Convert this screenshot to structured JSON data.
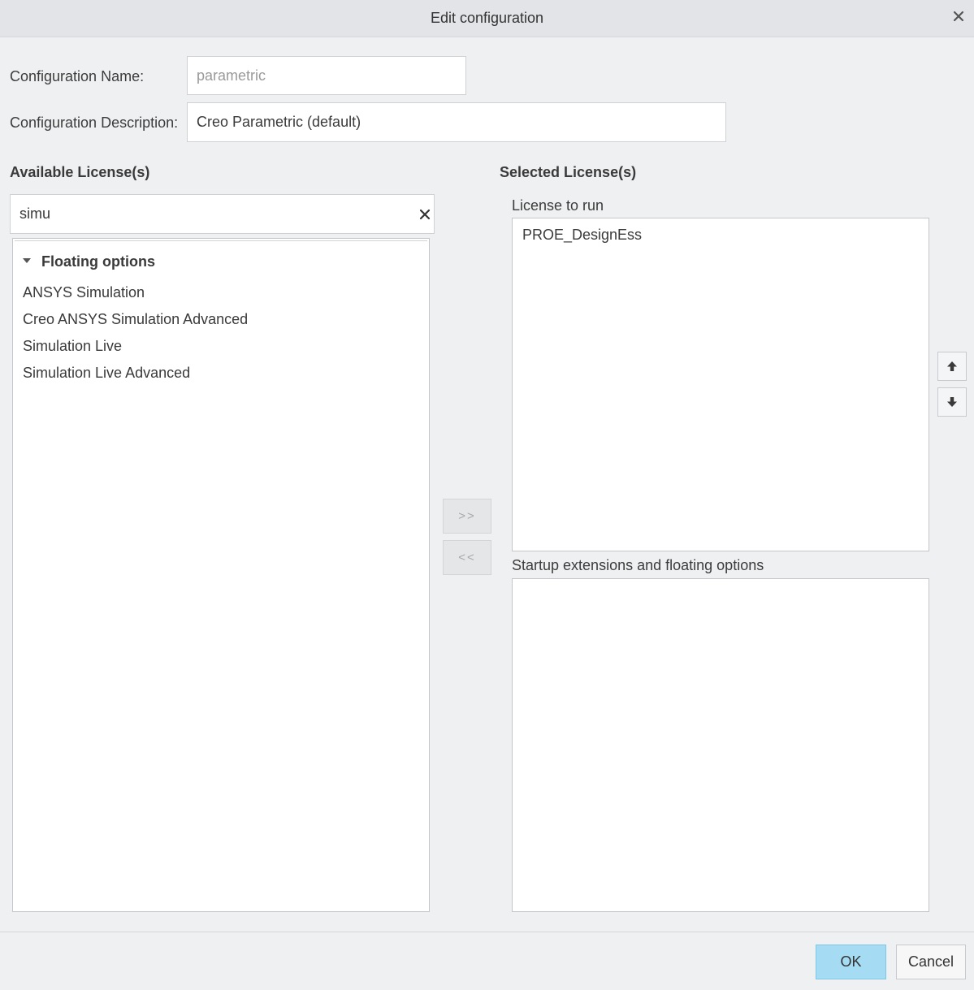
{
  "window": {
    "title": "Edit configuration"
  },
  "form": {
    "name_label": "Configuration Name:",
    "name_value": "parametric",
    "description_label": "Configuration Description:",
    "description_value": "Creo Parametric (default)"
  },
  "available": {
    "heading": "Available License(s)",
    "search_value": "simu",
    "group_label": "Floating options",
    "items": [
      "ANSYS Simulation",
      "Creo ANSYS Simulation Advanced",
      "Simulation Live",
      "Simulation Live Advanced"
    ]
  },
  "transfer": {
    "add_label": ">>",
    "remove_label": "<<"
  },
  "selected": {
    "heading": "Selected License(s)",
    "run_label": "License to run",
    "run_items": [
      "PROE_DesignEss"
    ],
    "startup_label": "Startup extensions and floating options",
    "startup_items": []
  },
  "footer": {
    "ok_label": "OK",
    "cancel_label": "Cancel"
  },
  "icons": {
    "close": "close-icon",
    "clear": "clear-search-icon",
    "expand": "triangle-down-icon",
    "up": "arrow-up-icon",
    "down": "arrow-down-icon"
  },
  "colors": {
    "ok_button": "#a5dcf3",
    "dialog_background": "#eff0f2",
    "titlebar_background": "#e2e4e7"
  }
}
